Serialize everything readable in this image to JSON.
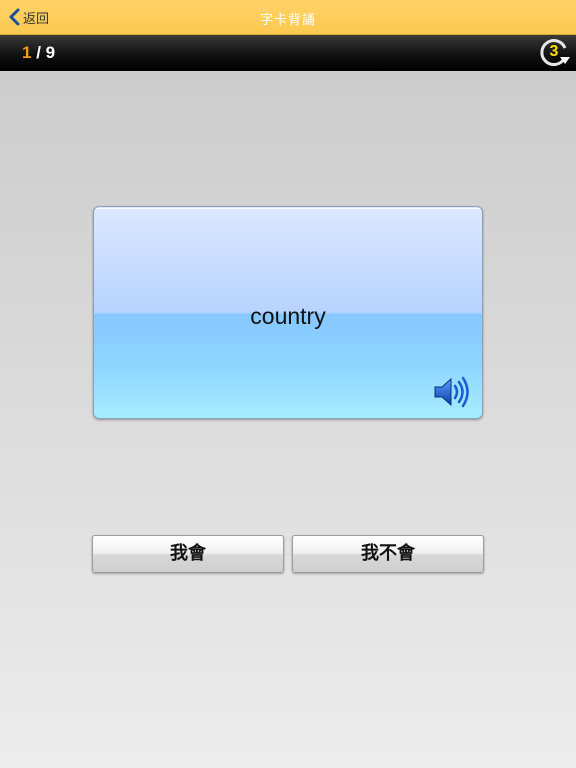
{
  "navbar": {
    "back_label": "返回",
    "title": "字卡背誦"
  },
  "progress": {
    "current": "1",
    "separator": " / ",
    "total": "9",
    "repeat_count": "3"
  },
  "card": {
    "word": "country"
  },
  "actions": {
    "know_label": "我會",
    "dont_know_label": "我不會"
  },
  "colors": {
    "navbar": "#fbc94e",
    "progress_bar": "#111111",
    "current_index": "#f39b1b",
    "repeat_count": "#ffe000",
    "card_top": "#dce8ff",
    "card_bottom": "#a6ecff"
  },
  "icons": {
    "back": "chevron-left-icon",
    "repeat": "repeat-cycle-icon",
    "speaker": "speaker-icon"
  }
}
